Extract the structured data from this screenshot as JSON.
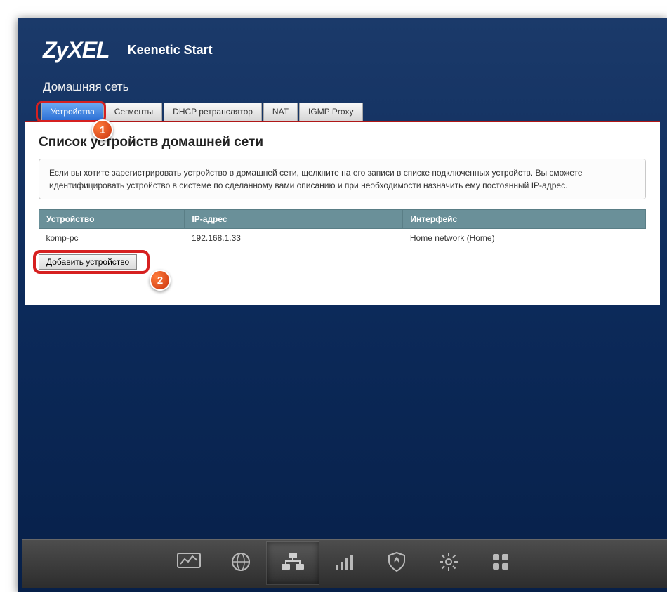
{
  "header": {
    "brand": "ZyXEL",
    "product": "Keenetic Start"
  },
  "section_title": "Домашняя сеть",
  "tabs": [
    {
      "label": "Устройства",
      "active": true
    },
    {
      "label": "Сегменты",
      "active": false
    },
    {
      "label": "DHCP ретранслятор",
      "active": false
    },
    {
      "label": "NAT",
      "active": false
    },
    {
      "label": "IGMP Proxy",
      "active": false
    }
  ],
  "panel": {
    "title": "Список устройств домашней сети",
    "info": "Если вы хотите зарегистрировать устройство в домашней сети, щелкните на его записи в списке подключенных устройств. Вы сможете идентифицировать устройство в системе по сделанному вами описанию и при необходимости назначить ему постоянный IP-адрес.",
    "columns": {
      "device": "Устройство",
      "ip": "IP-адрес",
      "iface": "Интерфейс"
    },
    "rows": [
      {
        "device": "komp-pc",
        "ip": "192.168.1.33",
        "iface": "Home network (Home)"
      }
    ],
    "add_button": "Добавить устройство"
  },
  "callouts": {
    "one": "1",
    "two": "2"
  },
  "nav_icons": [
    "monitor",
    "globe",
    "network",
    "signal",
    "firewall",
    "settings",
    "apps"
  ]
}
